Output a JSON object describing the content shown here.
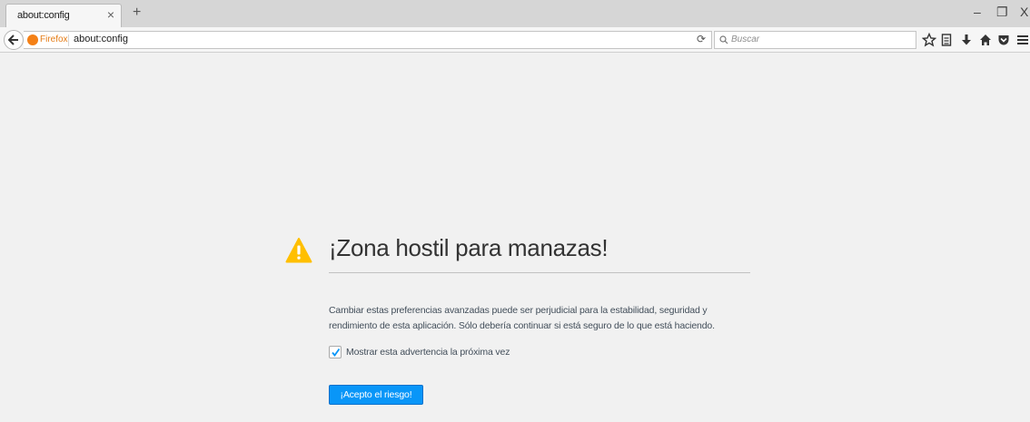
{
  "window": {
    "tab_title": "about:config",
    "tab_close": "×",
    "new_tab": "+",
    "minimize": "–",
    "restore": "❐",
    "close": "X"
  },
  "navbar": {
    "identity_label": "Firefox",
    "url": "about:config",
    "reload": "⟳",
    "search_placeholder": "Buscar"
  },
  "toolbar_icons": [
    "bookmark-star-icon",
    "reading-list-icon",
    "downloads-icon",
    "home-icon",
    "pocket-icon",
    "menu-icon"
  ],
  "warning": {
    "title": "¡Zona hostil para manazas!",
    "description": "Cambiar estas preferencias avanzadas puede ser perjudicial para la estabilidad, seguridad y rendimiento de esta aplicación. Sólo debería continuar si está seguro de lo que está haciendo.",
    "checkbox_label": "Mostrar esta advertencia la próxima vez",
    "checkbox_checked": true,
    "accept_button": "¡Acepto el riesgo!"
  },
  "colors": {
    "accent": "#0996f8",
    "warning": "#ffbf00",
    "firefox_orange": "#f48016"
  }
}
